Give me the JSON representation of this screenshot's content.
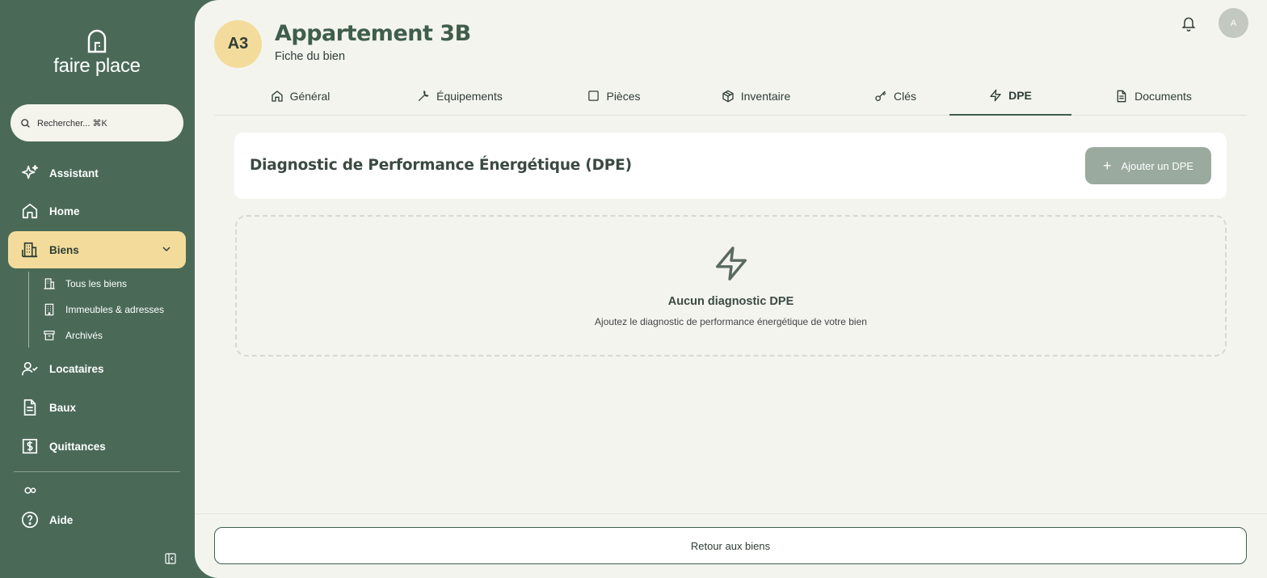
{
  "brand": {
    "name": "faire place"
  },
  "search": {
    "placeholder": "Rechercher... ⌘K"
  },
  "sidebar": {
    "items": [
      {
        "label": "Assistant",
        "icon": "sparkles-icon"
      },
      {
        "label": "Home",
        "icon": "home-icon"
      },
      {
        "label": "Biens",
        "icon": "building-icon",
        "active": true,
        "expanded": true
      },
      {
        "label": "Locataires",
        "icon": "user-check-icon"
      },
      {
        "label": "Baux",
        "icon": "document-icon"
      },
      {
        "label": "Quittances",
        "icon": "receipt-icon"
      },
      {
        "label": "Aide",
        "icon": "help-circle-icon"
      }
    ],
    "subitems": [
      {
        "label": "Tous les biens",
        "icon": "buildings-icon"
      },
      {
        "label": "Immeubles & adresses",
        "icon": "apartment-icon"
      },
      {
        "label": "Archivés",
        "icon": "archive-icon"
      }
    ]
  },
  "property": {
    "initials": "A3",
    "title": "Appartement 3B",
    "subtitle": "Fiche du bien"
  },
  "user": {
    "initial": "A"
  },
  "tabs": [
    {
      "label": "Général",
      "icon": "home-icon"
    },
    {
      "label": "Équipements",
      "icon": "wrench-icon"
    },
    {
      "label": "Pièces",
      "icon": "square-icon"
    },
    {
      "label": "Inventaire",
      "icon": "package-icon"
    },
    {
      "label": "Clés",
      "icon": "key-icon"
    },
    {
      "label": "DPE",
      "icon": "zap-icon",
      "active": true
    },
    {
      "label": "Documents",
      "icon": "file-icon"
    }
  ],
  "dpe": {
    "heading": "Diagnostic de Performance Énergétique (DPE)",
    "add_label": "Ajouter un DPE",
    "empty_title": "Aucun diagnostic DPE",
    "empty_sub": "Ajoutez le diagnostic de performance énergétique de votre bien"
  },
  "footer": {
    "back_label": "Retour aux biens"
  },
  "colors": {
    "sidebar": "#4a6a57",
    "accent": "#f3dc9b",
    "primary": "#3f5e4b",
    "background": "#f4f4ef"
  }
}
